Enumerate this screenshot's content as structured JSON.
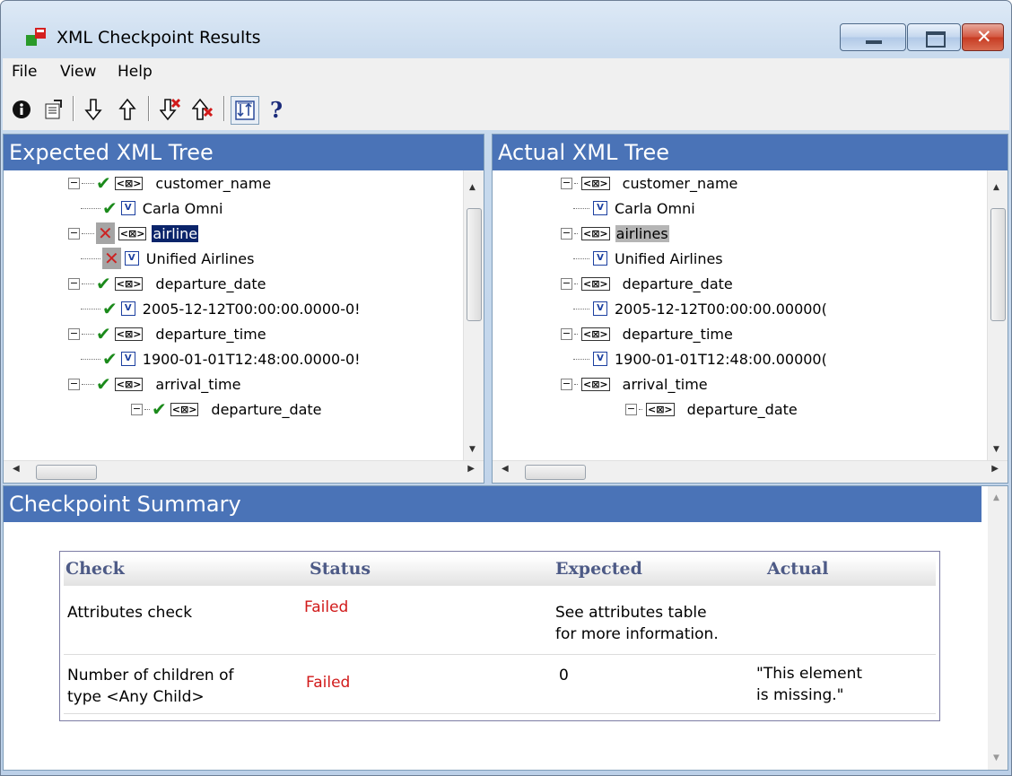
{
  "window": {
    "title": "XML Checkpoint Results"
  },
  "menu": {
    "items": [
      "File",
      "View",
      "Help"
    ]
  },
  "toolbar": {
    "icons": [
      "info-icon",
      "properties-icon",
      "next-check-icon",
      "previous-check-icon",
      "next-failed-icon",
      "previous-failed-icon",
      "sync-trees-icon",
      "help-icon"
    ]
  },
  "expected_pane": {
    "header": "Expected XML Tree",
    "nodes": [
      {
        "text": "customer_name",
        "status": "pass"
      },
      {
        "text": "Carla Omni",
        "status": "pass"
      },
      {
        "text": "airline",
        "status": "fail"
      },
      {
        "text": "Unified Airlines",
        "status": "fail"
      },
      {
        "text": "departure_date",
        "status": "pass"
      },
      {
        "text": "2005-12-12T00:00:00.0000-0!",
        "status": "pass"
      },
      {
        "text": "departure_time",
        "status": "pass"
      },
      {
        "text": "1900-01-01T12:48:00.0000-0!",
        "status": "pass"
      },
      {
        "text": "arrival_time",
        "status": "pass"
      },
      {
        "text": "departure_date",
        "status": "pass"
      }
    ]
  },
  "actual_pane": {
    "header": "Actual XML Tree",
    "nodes": [
      {
        "text": "customer_name"
      },
      {
        "text": "Carla Omni"
      },
      {
        "text": "airlines"
      },
      {
        "text": "Unified Airlines"
      },
      {
        "text": "departure_date"
      },
      {
        "text": "2005-12-12T00:00:00.00000("
      },
      {
        "text": "departure_time"
      },
      {
        "text": "1900-01-01T12:48:00.00000("
      },
      {
        "text": "arrival_time"
      },
      {
        "text": "departure_date"
      }
    ]
  },
  "summary": {
    "header": "Checkpoint Summary",
    "columns": [
      "Check",
      "Status",
      "Expected",
      "Actual"
    ],
    "rows": [
      {
        "check": "Attributes check",
        "status": "Failed",
        "expected_1": "See attributes table",
        "expected_2": "for more information.",
        "actual_1": "",
        "actual_2": ""
      },
      {
        "check_1": "Number of children of",
        "check_2": "type <Any Child>",
        "status": "Failed",
        "expected": "0",
        "actual_1": "\"This element",
        "actual_2": "is missing.\""
      }
    ]
  },
  "colors": {
    "header_blue": "#4a73b7",
    "failed_red": "#d11a1a",
    "pass_green": "#1b8a1b"
  }
}
